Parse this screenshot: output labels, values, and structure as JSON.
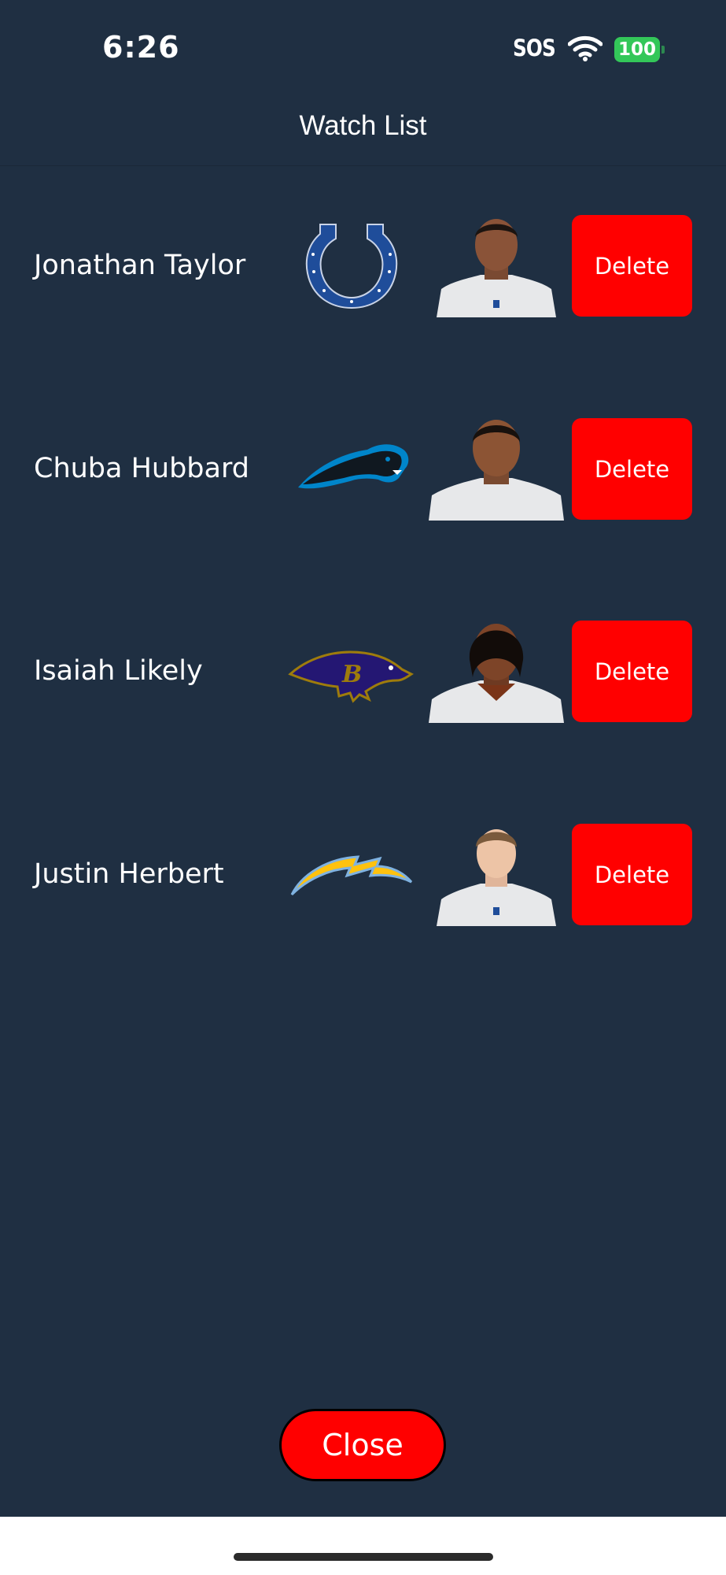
{
  "status_bar": {
    "time": "6:26",
    "sos": "SOS",
    "battery": "100",
    "battery_color": "#33c759"
  },
  "header": {
    "title": "Watch List"
  },
  "colors": {
    "background": "#1f2f42",
    "delete": "#ff0000",
    "close": "#ff0000"
  },
  "players": [
    {
      "name": "Jonathan Taylor",
      "team_logo": "colts-horseshoe-logo",
      "delete_label": "Delete"
    },
    {
      "name": "Chuba Hubbard",
      "team_logo": "panthers-logo",
      "delete_label": "Delete"
    },
    {
      "name": "Isaiah Likely",
      "team_logo": "ravens-logo",
      "delete_label": "Delete"
    },
    {
      "name": "Justin Herbert",
      "team_logo": "chargers-bolt-logo",
      "delete_label": "Delete"
    }
  ],
  "footer": {
    "close_label": "Close"
  }
}
